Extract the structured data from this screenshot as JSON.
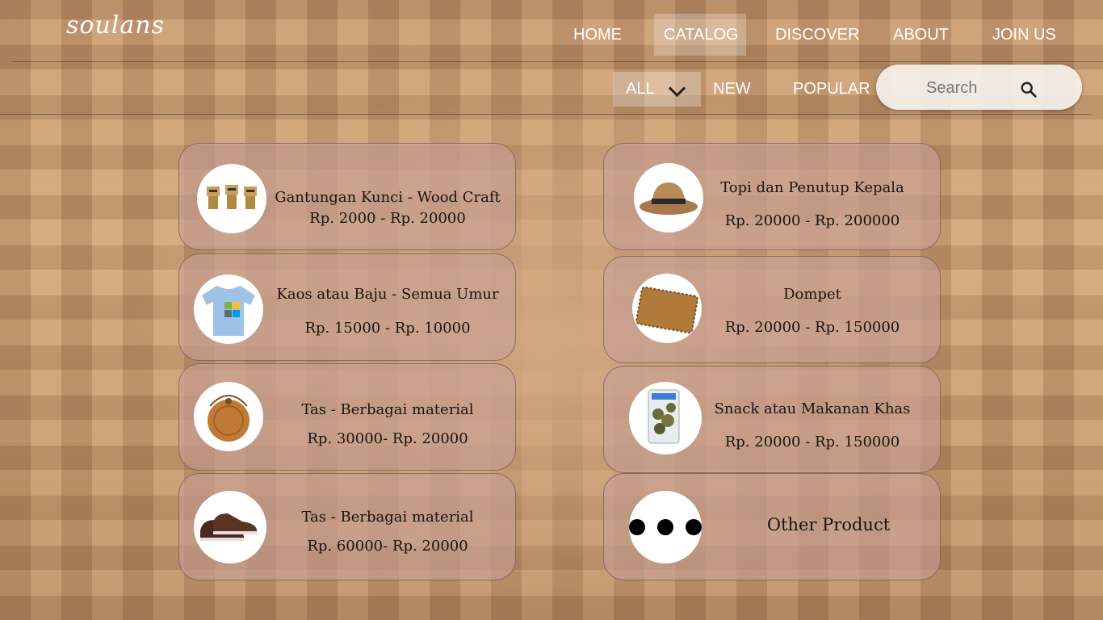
{
  "brand": {
    "logo": "soulans"
  },
  "nav": {
    "items": [
      {
        "label": "HOME"
      },
      {
        "label": "CATALOG",
        "active": true
      },
      {
        "label": "DISCOVER"
      },
      {
        "label": "ABOUT"
      },
      {
        "label": "JOIN US"
      }
    ]
  },
  "filters": {
    "selected": "ALL",
    "links": [
      "NEW",
      "POPULAR"
    ]
  },
  "search": {
    "placeholder": "Search",
    "icon": "search-icon"
  },
  "products": [
    {
      "title": "Gantungan Kunci - Wood Craft",
      "price": "Rp. 2000 - Rp. 20000",
      "icon": "wooden-figures"
    },
    {
      "title": "Topi dan Penutup Kepala",
      "price": "Rp. 20000 - Rp. 200000",
      "icon": "hat"
    },
    {
      "title": "Kaos atau Baju - Semua Umur",
      "price": "Rp. 15000 - Rp. 10000",
      "icon": "tshirt"
    },
    {
      "title": "Dompet",
      "price": "Rp. 20000 - Rp. 150000",
      "icon": "wallet"
    },
    {
      "title": "Tas - Berbagai material",
      "price": "Rp. 30000- Rp. 20000",
      "icon": "round-bag"
    },
    {
      "title": "Snack atau Makanan Khas",
      "price": "Rp. 20000 - Rp. 150000",
      "icon": "snack-pack"
    },
    {
      "title": "Tas - Berbagai material",
      "price": "Rp. 60000- Rp. 20000",
      "icon": "shoes"
    },
    {
      "title": "Other Product",
      "price": "",
      "icon": "more-dots"
    }
  ],
  "colors": {
    "card_bg": "#c6a096",
    "text": "#1a1410",
    "nav_text": "#ffffff"
  }
}
